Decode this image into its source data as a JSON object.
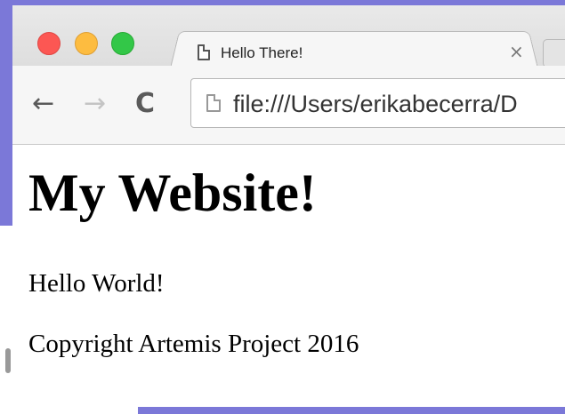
{
  "browser": {
    "tab": {
      "title": "Hello There!",
      "close_glyph": "×"
    },
    "nav": {
      "back_icon": "back-arrow-icon",
      "forward_icon": "forward-arrow-icon",
      "reload_icon": "reload-icon",
      "back_glyph": "←",
      "forward_glyph": "→",
      "reload_glyph": "C"
    },
    "address_bar": {
      "url": "file:///Users/erikabecerra/D"
    },
    "traffic_lights": {
      "close": "#fc5753",
      "minimize": "#fdbc40",
      "zoom": "#33c748"
    }
  },
  "page": {
    "heading": "My Website!",
    "paragraphs": [
      "Hello World!",
      "Copyright Artemis Project 2016"
    ]
  },
  "colors": {
    "slide_background": "#7b78d8"
  }
}
